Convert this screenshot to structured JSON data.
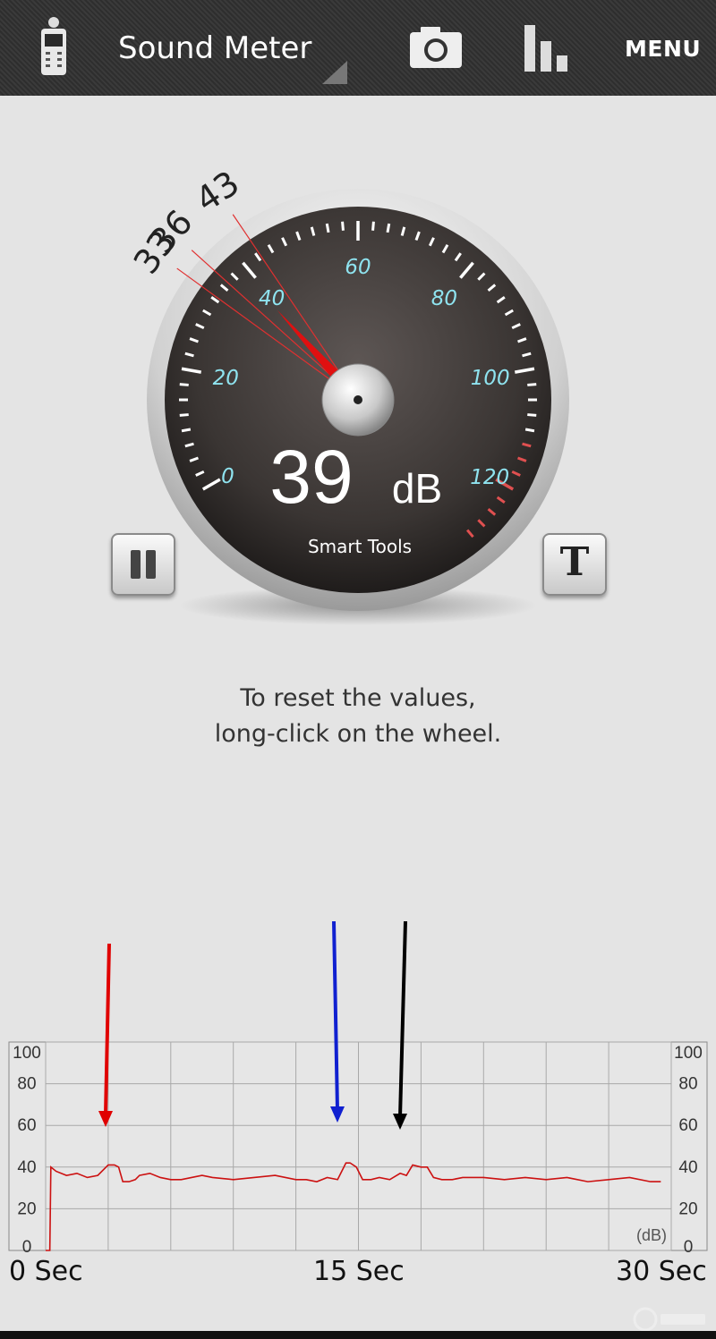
{
  "app": {
    "title": "Sound Meter",
    "menu_label": "MENU",
    "icons": [
      "sound-meter-app-icon",
      "camera-icon",
      "bar-chart-icon"
    ]
  },
  "gauge": {
    "reading_value": "39",
    "reading_unit": "dB",
    "brand": "Smart Tools",
    "scale_labels": [
      "0",
      "20",
      "40",
      "60",
      "80",
      "100",
      "120"
    ],
    "marker_labels": [
      "33",
      "36",
      "43"
    ],
    "needle_value": 39,
    "marker_values": [
      33,
      36,
      43
    ],
    "scale_min": 0,
    "scale_max": 130,
    "colors": {
      "needle": "#e01010",
      "scale_numbers": "#8fe3ef",
      "danger_ticks": "#e05050"
    }
  },
  "controls": {
    "pause_icon": "pause-icon",
    "text_button_label": "T"
  },
  "hint": {
    "line1": "To reset the values,",
    "line2": "long-click on the wheel."
  },
  "chart_data": {
    "type": "line",
    "y_ticks": [
      "100",
      "80",
      "60",
      "40",
      "20",
      "0"
    ],
    "unit_label": "(dB)",
    "ylim": [
      0,
      100
    ],
    "xlim": [
      0,
      30
    ],
    "x_labels": [
      "0 Sec",
      "15 Sec",
      "30 Sec"
    ],
    "series": [
      {
        "color": "#cc1111",
        "x": [
          0,
          0.2,
          0.25,
          0.5,
          1.0,
          1.5,
          2.0,
          2.5,
          3.0,
          3.3,
          3.5,
          3.7,
          4.0,
          4.3,
          4.5,
          5.0,
          5.5,
          6.0,
          6.5,
          7.0,
          7.5,
          8.0,
          9.0,
          10.0,
          11.0,
          12.0,
          12.5,
          13.0,
          13.5,
          14.0,
          14.4,
          14.6,
          14.9,
          15.2,
          15.6,
          16.0,
          16.5,
          17.0,
          17.3,
          17.6,
          18.0,
          18.3,
          18.6,
          19.0,
          19.5,
          20.0,
          21.0,
          22.0,
          23.0,
          24.0,
          25.0,
          26.0,
          27.0,
          28.0,
          29.0,
          29.5
        ],
        "y": [
          0,
          0,
          40,
          38,
          36,
          37,
          35,
          36,
          41,
          41,
          40,
          33,
          33,
          34,
          36,
          37,
          35,
          34,
          34,
          35,
          36,
          35,
          34,
          35,
          36,
          34,
          34,
          33,
          35,
          34,
          42,
          42,
          40,
          34,
          34,
          35,
          34,
          37,
          36,
          41,
          40,
          40,
          35,
          34,
          34,
          35,
          35,
          34,
          35,
          34,
          35,
          33,
          34,
          35,
          33,
          33
        ]
      }
    ],
    "annotation_arrows": [
      {
        "color": "#e00000",
        "x": 3.0
      },
      {
        "color": "#1020d0",
        "x": 14.0
      },
      {
        "color": "#000000",
        "x": 18.5
      }
    ]
  }
}
